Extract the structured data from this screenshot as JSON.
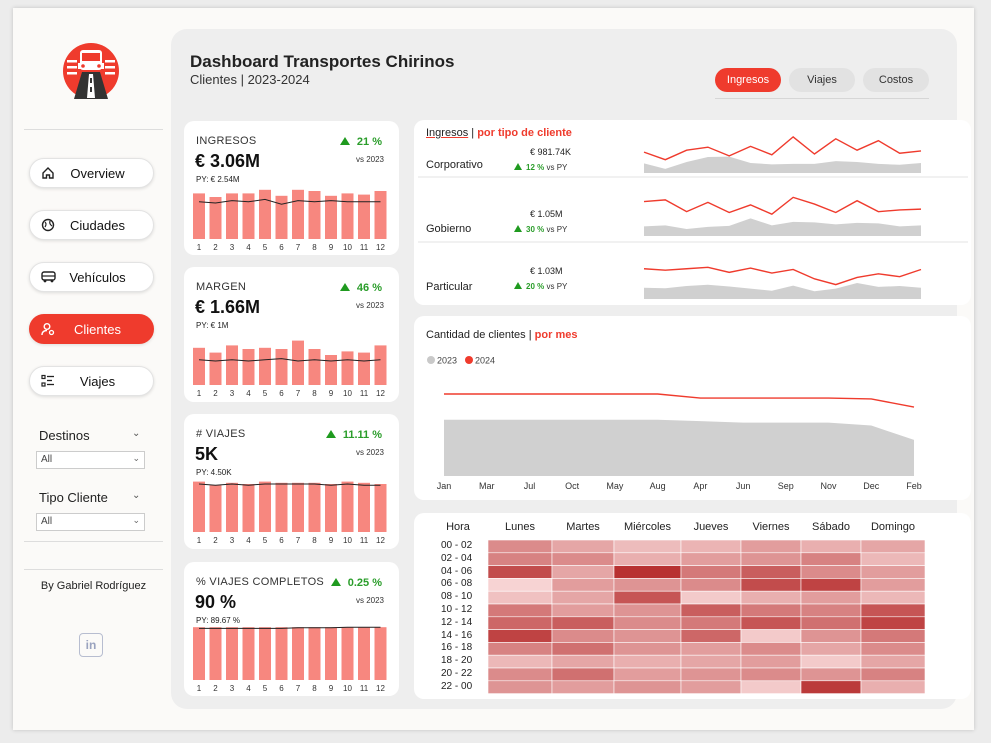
{
  "sidebar": {
    "nav": [
      {
        "label": "Overview",
        "icon": "home-icon",
        "active": false
      },
      {
        "label": "Ciudades",
        "icon": "globe-icon",
        "active": false
      },
      {
        "label": "Vehículos",
        "icon": "bus-icon",
        "active": false
      },
      {
        "label": "Clientes",
        "icon": "user-gear-icon",
        "active": true
      },
      {
        "label": "Viajes",
        "icon": "list-icon",
        "active": false
      }
    ],
    "filters": [
      {
        "label": "Destinos",
        "value": "All"
      },
      {
        "label": "Tipo Cliente",
        "value": "All"
      }
    ],
    "author": "By Gabriel Rodríguez",
    "linkedin": "in"
  },
  "header": {
    "title": "Dashboard Transportes Chirinos",
    "subtitle": "Clientes | 2023-2024",
    "tabs": [
      {
        "label": "Ingresos",
        "active": true
      },
      {
        "label": "Viajes",
        "active": false
      },
      {
        "label": "Costos",
        "active": false
      }
    ]
  },
  "colors": {
    "accent": "#ef3b2d",
    "bar": "#f7877f",
    "gray": "#d0d0d0",
    "positive": "#2a9d2a"
  },
  "kpis": [
    {
      "title": "INGRESOS",
      "value": "€ 3.06M",
      "py": "PY: € 2.54M",
      "change": "21 %",
      "vs": "vs 2023",
      "bars": [
        0.76,
        0.7,
        0.76,
        0.76,
        0.82,
        0.72,
        0.82,
        0.8,
        0.72,
        0.76,
        0.74,
        0.8
      ],
      "line": [
        0.62,
        0.6,
        0.64,
        0.62,
        0.66,
        0.58,
        0.64,
        0.62,
        0.64,
        0.62,
        0.62,
        0.62
      ]
    },
    {
      "title": "MARGEN",
      "value": "€ 1.66M",
      "py": "PY: € 1M",
      "change": "46 %",
      "vs": "vs 2023",
      "bars": [
        0.62,
        0.54,
        0.66,
        0.6,
        0.62,
        0.6,
        0.74,
        0.6,
        0.5,
        0.56,
        0.54,
        0.66
      ],
      "line": [
        0.42,
        0.4,
        0.42,
        0.4,
        0.42,
        0.44,
        0.4,
        0.42,
        0.4,
        0.42,
        0.4,
        0.42
      ]
    },
    {
      "title": "# VIAJES",
      "value": "5K",
      "py": "PY: 4.50K",
      "change": "11.11 %",
      "vs": "vs 2023",
      "bars": [
        0.84,
        0.78,
        0.82,
        0.8,
        0.84,
        0.82,
        0.82,
        0.82,
        0.8,
        0.84,
        0.82,
        0.8
      ],
      "line": [
        0.8,
        0.78,
        0.8,
        0.78,
        0.8,
        0.8,
        0.8,
        0.8,
        0.78,
        0.8,
        0.78,
        0.78
      ]
    },
    {
      "title": "% VIAJES COMPLETOS",
      "value": "90 %",
      "py": "PY: 89.67 %",
      "change": "0.25 %",
      "vs": "vs 2023",
      "bars": [
        0.88,
        0.88,
        0.88,
        0.88,
        0.88,
        0.88,
        0.88,
        0.88,
        0.88,
        0.88,
        0.88,
        0.88
      ],
      "line": [
        0.86,
        0.86,
        0.86,
        0.86,
        0.86,
        0.86,
        0.87,
        0.87,
        0.87,
        0.88,
        0.88,
        0.88
      ]
    }
  ],
  "months_num": [
    "1",
    "2",
    "3",
    "4",
    "5",
    "6",
    "7",
    "8",
    "9",
    "10",
    "11",
    "12"
  ],
  "segments": {
    "title_a": "Ingresos",
    "title_b": "por tipo de cliente",
    "rows": [
      {
        "name": "Corporativo",
        "value": "€ 981.74K",
        "change": "12 %",
        "vs": "vs PY",
        "area": [
          0.42,
          0.18,
          0.48,
          0.7,
          0.72,
          0.44,
          0.38,
          0.4,
          0.4,
          0.52,
          0.48,
          0.4,
          0.36,
          0.44
        ],
        "line": [
          0.55,
          0.35,
          0.6,
          0.68,
          0.45,
          0.7,
          0.48,
          0.95,
          0.5,
          0.9,
          0.6,
          0.85,
          0.52,
          0.58
        ]
      },
      {
        "name": "Gobierno",
        "value": "€ 1.05M",
        "change": "30 %",
        "vs": "vs PY",
        "area": [
          0.38,
          0.42,
          0.28,
          0.36,
          0.4,
          0.7,
          0.42,
          0.56,
          0.54,
          0.46,
          0.52,
          0.5,
          0.38,
          0.42
        ],
        "line": [
          0.82,
          0.86,
          0.58,
          0.8,
          0.56,
          0.74,
          0.52,
          0.92,
          0.76,
          0.56,
          0.84,
          0.58,
          0.62,
          0.64
        ]
      },
      {
        "name": "Particular",
        "value": "€ 1.03M",
        "change": "20 %",
        "vs": "vs PY",
        "area": [
          0.52,
          0.5,
          0.6,
          0.66,
          0.58,
          0.48,
          0.38,
          0.62,
          0.36,
          0.48,
          0.74,
          0.56,
          0.6,
          0.52
        ],
        "line": [
          0.84,
          0.8,
          0.84,
          0.88,
          0.74,
          0.86,
          0.72,
          0.82,
          0.56,
          0.4,
          0.6,
          0.7,
          0.62,
          0.82
        ]
      }
    ]
  },
  "clients_chart": {
    "title_a": "Cantidad de clientes",
    "title_b": "por mes",
    "legend": [
      {
        "name": "2023",
        "color": "#c9c9c9"
      },
      {
        "name": "2024",
        "color": "#ef3b2d"
      }
    ],
    "months": [
      "Jan",
      "Mar",
      "Jul",
      "Oct",
      "May",
      "Aug",
      "Apr",
      "Jun",
      "Sep",
      "Nov",
      "Dec",
      "Feb"
    ]
  },
  "chart_data": {
    "type": "area",
    "title": "Cantidad de clientes por mes",
    "categories": [
      "Jan",
      "Mar",
      "Jul",
      "Oct",
      "May",
      "Aug",
      "Apr",
      "Jun",
      "Sep",
      "Nov",
      "Dec",
      "Feb"
    ],
    "series": [
      {
        "name": "2023",
        "type": "area",
        "values": [
          0.78,
          0.78,
          0.78,
          0.78,
          0.78,
          0.78,
          0.76,
          0.74,
          0.74,
          0.74,
          0.7,
          0.5
        ]
      },
      {
        "name": "2024",
        "type": "line",
        "values": [
          1.0,
          1.0,
          1.0,
          1.0,
          1.0,
          1.0,
          0.95,
          0.95,
          0.95,
          0.95,
          0.94,
          0.84
        ]
      }
    ]
  },
  "heatmap": {
    "corner": "Hora",
    "days": [
      "Lunes",
      "Martes",
      "Miércoles",
      "Jueves",
      "Viernes",
      "Sábado",
      "Domingo"
    ],
    "hours": [
      "00 - 02",
      "02 - 04",
      "04 - 06",
      "06 - 08",
      "08 - 10",
      "10 - 12",
      "12 - 14",
      "14 - 16",
      "16 - 18",
      "18 - 20",
      "20 - 22",
      "22 - 00"
    ],
    "values": [
      [
        0.45,
        0.3,
        0.18,
        0.22,
        0.35,
        0.25,
        0.3
      ],
      [
        0.5,
        0.45,
        0.25,
        0.35,
        0.4,
        0.5,
        0.2
      ],
      [
        0.8,
        0.3,
        0.95,
        0.55,
        0.7,
        0.45,
        0.35
      ],
      [
        0.05,
        0.35,
        0.4,
        0.45,
        0.8,
        0.85,
        0.35
      ],
      [
        0.15,
        0.3,
        0.75,
        0.1,
        0.25,
        0.35,
        0.2
      ],
      [
        0.55,
        0.35,
        0.4,
        0.7,
        0.55,
        0.5,
        0.75
      ],
      [
        0.65,
        0.7,
        0.45,
        0.55,
        0.75,
        0.6,
        0.85
      ],
      [
        0.85,
        0.45,
        0.4,
        0.65,
        0.1,
        0.4,
        0.55
      ],
      [
        0.5,
        0.6,
        0.4,
        0.35,
        0.45,
        0.3,
        0.45
      ],
      [
        0.2,
        0.3,
        0.25,
        0.3,
        0.35,
        0.1,
        0.3
      ],
      [
        0.45,
        0.6,
        0.35,
        0.4,
        0.45,
        0.4,
        0.5
      ],
      [
        0.4,
        0.35,
        0.4,
        0.35,
        0.1,
        0.9,
        0.25
      ]
    ]
  }
}
